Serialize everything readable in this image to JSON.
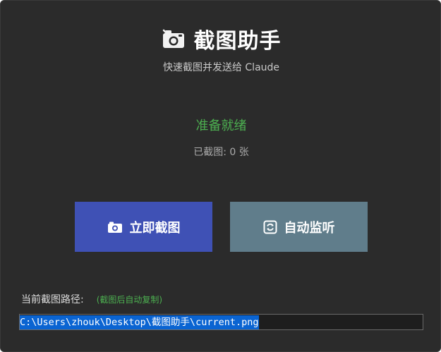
{
  "header": {
    "icon": "camera-icon",
    "title": "截图助手",
    "subtitle": "快速截图并发送给 Claude"
  },
  "status": {
    "text": "准备就绪",
    "count_text": "已截图: 0 张",
    "color": "#4caf50"
  },
  "buttons": {
    "capture": {
      "label": "立即截图",
      "icon": "camera-icon",
      "color": "#3f51b5"
    },
    "monitor": {
      "label": "自动监听",
      "icon": "refresh-icon",
      "color": "#607d8b"
    }
  },
  "path": {
    "label": "当前截图路径:",
    "hint": "(截图后自动复制)",
    "value": "C:\\Users\\zhouk\\Desktop\\截图助手\\current.png"
  },
  "colors": {
    "background": "#2b2b2b",
    "accent_green": "#4caf50",
    "selection": "#0a64d2"
  }
}
